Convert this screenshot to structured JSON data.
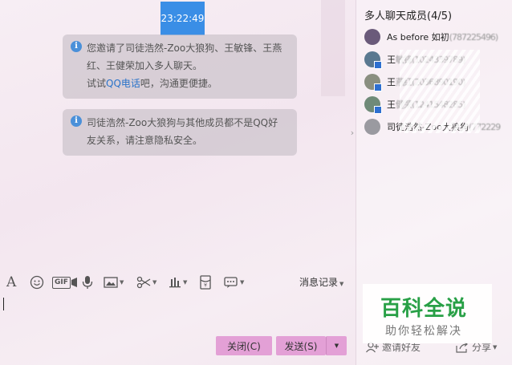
{
  "chat": {
    "timestamp": "23:22:49",
    "notice1": {
      "line1": "您邀请了司徒浩然-Zoo大狼狗、王敏锋、王燕",
      "line2": "红、王健荣加入多人聊天。",
      "line3_prefix": "试试",
      "line3_link": "QQ电话",
      "line3_suffix": "吧，沟通更便捷。"
    },
    "notice2": {
      "line1": "司徒浩然-Zoo大狼狗与其他成员都不是QQ好",
      "line2": "友关系，请注意隐私安全。"
    }
  },
  "toolbar": {
    "font_icon": "A",
    "gif_label": "GIF",
    "history_label": "消息记录"
  },
  "input": {
    "value": ""
  },
  "buttons": {
    "close": "关闭(C)",
    "send": "发送(S)"
  },
  "members": {
    "title": "多人聊天成员(4/5)",
    "list": [
      {
        "name": "As before 如初",
        "id_blurred": "(787225496)",
        "avatar_color": "#6a5a7a"
      },
      {
        "name": "王",
        "id_blurred": "敏锋(1024339789)",
        "avatar_color": "#5a7890"
      },
      {
        "name": "王",
        "id_blurred": "燕红(2036890190)",
        "avatar_color": "#8a8f80"
      },
      {
        "name": "王",
        "id_blurred": "健荣(1241548285)",
        "avatar_color": "#6f8a78"
      },
      {
        "name": "司徒浩然-Zoo大狼狗",
        "id_blurred": "(772229",
        "avatar_color": "#9a9aa0"
      }
    ]
  },
  "watermark": {
    "title": "百科全说",
    "subtitle": "助你轻松解决"
  },
  "bottom": {
    "invite_label": "邀请好友",
    "share_label": "分享"
  },
  "colors": {
    "timestamp_bg": "#3a8ee6",
    "button_bg": "#e3a0d6",
    "link": "#2a73c9",
    "watermark_green": "#28a046"
  }
}
